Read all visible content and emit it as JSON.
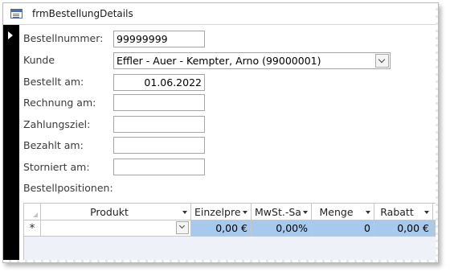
{
  "window": {
    "title": "frmBestellungDetails",
    "icon": "form-icon"
  },
  "fields": {
    "bestellnummer": {
      "label": "Bestellnummer:",
      "value": "99999999"
    },
    "kunde": {
      "label": "Kunde",
      "value": "Effler - Auer - Kempter, Arno (99000001)"
    },
    "bestellt_am": {
      "label": "Bestellt am:",
      "value": "01.06.2022"
    },
    "rechnung_am": {
      "label": "Rechnung am:",
      "value": ""
    },
    "zahlungsziel": {
      "label": "Zahlungsziel:",
      "value": ""
    },
    "bezahlt_am": {
      "label": "Bezahlt am:",
      "value": ""
    },
    "storniert_am": {
      "label": "Storniert am:",
      "value": ""
    }
  },
  "subform": {
    "label": "Bestellpositionen:",
    "columns": [
      "Produkt",
      "Einzelpre",
      "MwSt.-Sa",
      "Menge",
      "Rabatt"
    ],
    "new_row_marker": "*",
    "row": {
      "produkt": "",
      "einzelpreis": "0,00 €",
      "mwst": "0,00%",
      "menge": "0",
      "rabatt": "0,00 €"
    }
  },
  "colors": {
    "record_selector": "#000000",
    "new_row_highlight": "#a6c9ec"
  }
}
